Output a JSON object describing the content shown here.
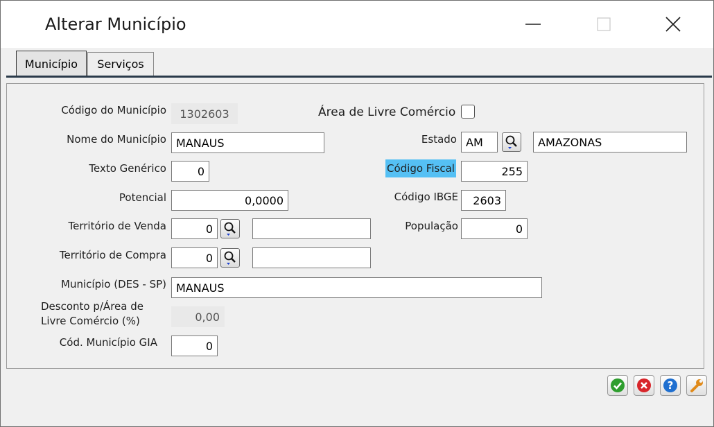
{
  "window": {
    "title": "Alterar Município"
  },
  "tabs": [
    {
      "label": "Município"
    },
    {
      "label": "Serviços"
    }
  ],
  "form": {
    "codigo": {
      "label": "Código do Município",
      "value": "1302603"
    },
    "livre_comercio": {
      "label": "Área de Livre Comércio",
      "checked": false
    },
    "nome": {
      "label": "Nome do Município",
      "value": "MANAUS"
    },
    "estado": {
      "label": "Estado",
      "value": "AM",
      "description": "AMAZONAS"
    },
    "texto_generico": {
      "label": "Texto Genérico",
      "value": "0"
    },
    "codigo_fiscal": {
      "label": "Código Fiscal",
      "value": "255"
    },
    "potencial": {
      "label": "Potencial",
      "value": "0,0000"
    },
    "codigo_ibge": {
      "label": "Código IBGE",
      "value": "2603"
    },
    "territorio_venda": {
      "label": "Território de Venda",
      "value": "0",
      "description": ""
    },
    "populacao": {
      "label": "População",
      "value": "0"
    },
    "territorio_compra": {
      "label": "Território de Compra",
      "value": "0",
      "description": ""
    },
    "municipio_des_sp": {
      "label": "Município (DES - SP)",
      "value": "MANAUS"
    },
    "desconto": {
      "label_line1": "Desconto p/Área de",
      "label_line2": "Livre Comércio (%)",
      "value": "0,00"
    },
    "cod_gia": {
      "label": "Cód. Município GIA",
      "value": "0"
    }
  },
  "actions": {
    "icons": [
      "check-icon",
      "cancel-icon",
      "help-icon",
      "wrench-icon"
    ]
  },
  "colors": {
    "highlight": "#55c0f4",
    "ok": "#2e9e2e",
    "cancel": "#d8262b",
    "help": "#1e6fd0",
    "tools": "#e08a1a"
  }
}
